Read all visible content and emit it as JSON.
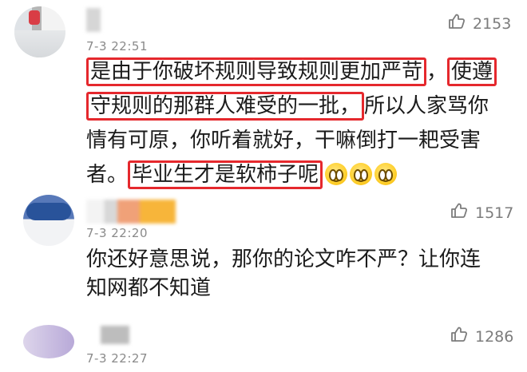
{
  "comments": [
    {
      "time": "7-3 22:51",
      "likes": "2153",
      "lines": [
        [
          "是由于你破坏规则导致规则更加严苛",
          "，",
          "使遵"
        ],
        [
          "守规则的那群人难受的一批，",
          "所以人家骂你"
        ],
        [
          "情有可原，你听着就好，干嘛倒打一耙受害"
        ],
        [
          "者。",
          "毕业生才是软柿子呢"
        ]
      ]
    },
    {
      "time": "7-3 22:20",
      "likes": "1517",
      "lines": [
        "你还好意思说，那你的论文咋不严？让你连",
        "知网都不知道"
      ]
    },
    {
      "time": "7-3 22:27",
      "likes": "1286"
    }
  ],
  "icons": {
    "like": "thumbs-up-icon",
    "emoji": "grin-emoji-icon"
  },
  "colors": {
    "highlight": "#e5282d",
    "text": "#1b1b1b",
    "muted": "#8a8a8a"
  }
}
